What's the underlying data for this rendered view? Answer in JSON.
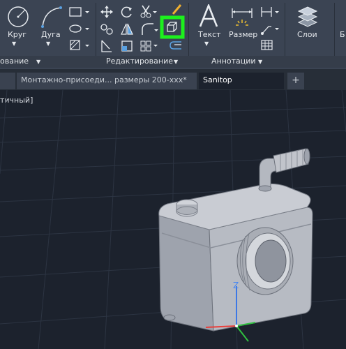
{
  "ribbon": {
    "draw_panel": {
      "title": "ование",
      "circle_label": "Круг",
      "arc_label": "Дуга"
    },
    "modify_panel": {
      "title": "Редактирование"
    },
    "annotation_panel": {
      "title": "Аннотации",
      "text_label": "Текст",
      "dimension_label": "Размер"
    },
    "layers_panel": {
      "layers_label": "Слои",
      "cut_label": "Б"
    }
  },
  "tabs": [
    {
      "label": "Монтажно-присоеди... размеры 200-ххх*"
    },
    {
      "label": "Sanitop"
    }
  ],
  "viewport": {
    "label": "тичный]",
    "axis_z": "Z"
  },
  "colors": {
    "highlight": "#1df01d",
    "ribbon_bg": "#3b4453",
    "viewport_bg": "#1c222d",
    "grid": "#2c3442"
  }
}
